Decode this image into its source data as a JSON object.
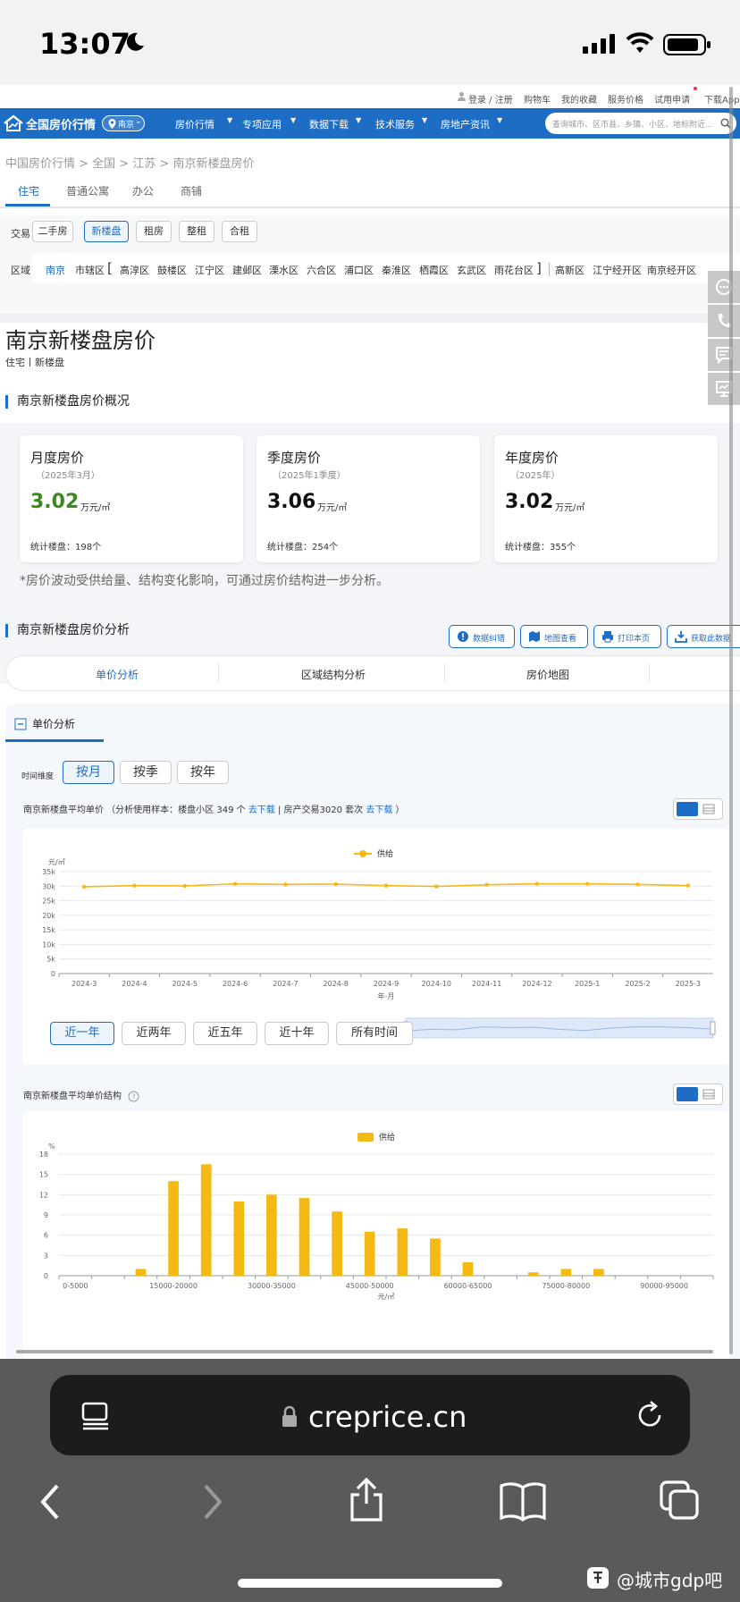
{
  "status": {
    "time": "13:07"
  },
  "topbar": {
    "login": "登录 / 注册",
    "cart": "购物车",
    "favorites": "我的收藏",
    "price_service": "服务价格",
    "trial": "试用申请",
    "download": "下载App"
  },
  "nav": {
    "logo": "全国房价行情",
    "city": "南京",
    "items": [
      "房价行情",
      "专项应用",
      "数据下载",
      "技术服务",
      "房地产资讯"
    ],
    "search_placeholder": "查询城市、区市县、乡镇、小区、地标附近..."
  },
  "breadcrumb": "中国房价行情 > 全国 > 江苏 > 南京新楼盘房价",
  "property_tabs": [
    "住宅",
    "普通公寓",
    "办公",
    "商铺"
  ],
  "filters": {
    "trade_label": "交易",
    "trades": [
      "二手房",
      "新楼盘",
      "租房",
      "整租",
      "合租"
    ],
    "area_label": "区域",
    "areas": [
      "南京",
      "市辖区",
      "高淳区",
      "鼓楼区",
      "江宁区",
      "建邺区",
      "溧水区",
      "六合区",
      "浦口区",
      "秦淮区",
      "栖霞区",
      "玄武区",
      "雨花台区",
      "高新区",
      "江宁经开区",
      "南京经开区"
    ],
    "bracket_open": "[",
    "bracket_close": "]"
  },
  "page_title": "南京新楼盘房价",
  "page_subtitle": "住宅丨新楼盘",
  "overview": {
    "title": "南京新楼盘房价概况",
    "cards": [
      {
        "title": "月度房价",
        "period": "（2025年3月）",
        "value": "3.02",
        "unit": "万元/㎡",
        "count": "统计楼盘：198个",
        "color": "#3a8a1f"
      },
      {
        "title": "季度房价",
        "period": "（2025年1季度）",
        "value": "3.06",
        "unit": "万元/㎡",
        "count": "统计楼盘：254个",
        "color": "#111111"
      },
      {
        "title": "年度房价",
        "period": "（2025年）",
        "value": "3.02",
        "unit": "万元/㎡",
        "count": "统计楼盘：355个",
        "color": "#111111"
      }
    ],
    "note": "*房价波动受供给量、结构变化影响，可通过房价结构进一步分析。"
  },
  "analysis": {
    "title": "南京新楼盘房价分析",
    "actions": [
      "数据纠错",
      "地图查看",
      "打印本页",
      "获取此数据"
    ],
    "segments": [
      "单价分析",
      "区域结构分析",
      "房价地图"
    ],
    "panel_title": "单价分析",
    "time_label": "时间维度",
    "time_buttons": [
      "按月",
      "按季",
      "按年"
    ],
    "line_title_prefix": "南京新楼盘平均单价 （分析使用样本：楼盘小区 349 个 ",
    "line_title_link1": "去下载",
    "line_title_mid": " | 房产交易3020 套次 ",
    "line_title_link2": "去下载",
    "line_title_suffix": " ）",
    "range_buttons": [
      "近一年",
      "近两年",
      "近五年",
      "近十年",
      "所有时间"
    ],
    "bar_title": "南京新楼盘平均单价结构"
  },
  "chart_data": [
    {
      "type": "line",
      "title": "",
      "legend": "供给",
      "ylabel": "元/㎡",
      "xlabel": "年-月",
      "x": [
        "2024-3",
        "2024-4",
        "2024-5",
        "2024-6",
        "2024-7",
        "2024-8",
        "2024-9",
        "2024-10",
        "2024-11",
        "2024-12",
        "2025-1",
        "2025-2",
        "2025-3"
      ],
      "values": [
        29800,
        30200,
        30100,
        30800,
        30600,
        30700,
        30200,
        29900,
        30500,
        30800,
        30800,
        30600,
        30200
      ],
      "ylim": [
        0,
        35000
      ],
      "yticks": [
        "0",
        "5k",
        "10k",
        "15k",
        "20k",
        "25k",
        "30k",
        "35k"
      ],
      "color": "#f5b914",
      "grid": true
    },
    {
      "type": "bar",
      "title": "",
      "legend": "供给",
      "ylabel": "%",
      "xlabel": "元/㎡",
      "bins": 20,
      "xticks": [
        "0-5000",
        "15000-20000",
        "30000-35000",
        "45000-50000",
        "60000-65000",
        "75000-80000",
        "90000-95000"
      ],
      "values": [
        0,
        0,
        1,
        14,
        16.5,
        11,
        12,
        11.5,
        9.5,
        6.5,
        7,
        5.5,
        2,
        0,
        0.5,
        1,
        1,
        0,
        0,
        0
      ],
      "ylim": [
        0,
        18
      ],
      "yticks": [
        "0",
        "3",
        "6",
        "9",
        "12",
        "15",
        "18"
      ],
      "color": "#f5b914",
      "grid": true
    }
  ],
  "browser": {
    "url": "creprice.cn"
  },
  "watermark": "@城市gdp吧"
}
